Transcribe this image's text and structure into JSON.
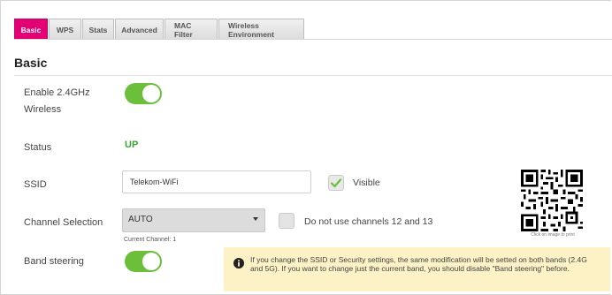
{
  "tabs": [
    {
      "label": "Basic",
      "active": true
    },
    {
      "label": "WPS",
      "active": false
    },
    {
      "label": "Stats",
      "active": false
    },
    {
      "label": "Advanced",
      "active": false
    },
    {
      "label": "MAC Filter",
      "active": false
    },
    {
      "label": "Wireless Environment",
      "active": false
    }
  ],
  "section_title": "Basic",
  "fields": {
    "enable_wireless": {
      "label_line1": "Enable 2.4GHz",
      "label_line2": "Wireless",
      "enabled": true
    },
    "status": {
      "label": "Status",
      "value": "UP"
    },
    "ssid": {
      "label": "SSID",
      "value": "Telekom-WiFi",
      "visible_label": "Visible",
      "visible_checked": true
    },
    "channel": {
      "label": "Channel Selection",
      "selected": "AUTO",
      "current_channel_text": "Current Channel: 1",
      "no_12_13_label": "Do not use channels 12 and 13",
      "no_12_13_checked": false
    },
    "band_steering": {
      "label": "Band steering",
      "enabled": true
    }
  },
  "qr": {
    "caption": "Click on image to print"
  },
  "info_message": "If you change the SSID or Security settings, the same modification will be setted on both bands (2.4G and 5G). If you want to change just the current band, you should disable \"Band steering\" before.",
  "colors": {
    "accent": "#e20074",
    "toggle_on": "#6cbf3a",
    "status_up": "#3aa335",
    "info_bg": "#fcf2c5"
  }
}
